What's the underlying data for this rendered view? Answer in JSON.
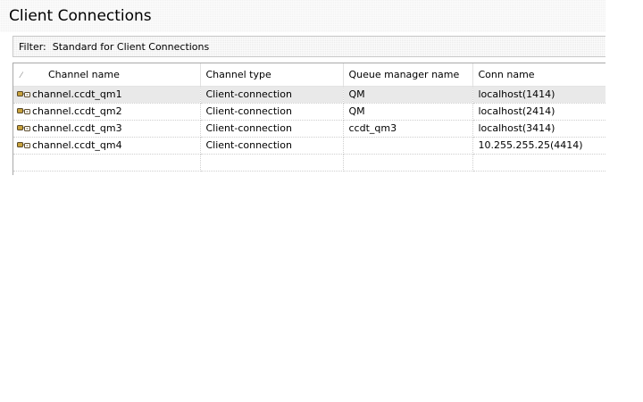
{
  "title": "Client Connections",
  "filter": {
    "label": "Filter:",
    "value": "Standard for Client Connections"
  },
  "table": {
    "columns": [
      "Channel name",
      "Channel type",
      "Queue manager name",
      "Conn name"
    ],
    "sort_icon": "sort-indicator-icon",
    "row_icon": "channel-icon",
    "rows": [
      {
        "channel_name": "channel.ccdt_qm1",
        "channel_type": "Client-connection",
        "queue_manager": "QM",
        "conn_name": "localhost(1414)",
        "selected": true
      },
      {
        "channel_name": "channel.ccdt_qm2",
        "channel_type": "Client-connection",
        "queue_manager": "QM",
        "conn_name": "localhost(2414)",
        "selected": false
      },
      {
        "channel_name": "channel.ccdt_qm3",
        "channel_type": "Client-connection",
        "queue_manager": "ccdt_qm3",
        "conn_name": "localhost(3414)",
        "selected": false
      },
      {
        "channel_name": "channel.ccdt_qm4",
        "channel_type": "Client-connection",
        "queue_manager": "",
        "conn_name": "10.255.255.25(4414)",
        "selected": false
      }
    ]
  },
  "colors": {
    "selected_row": "#e9e9e9",
    "grid_line": "#cfcfcf",
    "icon_gold": "#c8a23c",
    "icon_dark": "#5a4a2a"
  }
}
